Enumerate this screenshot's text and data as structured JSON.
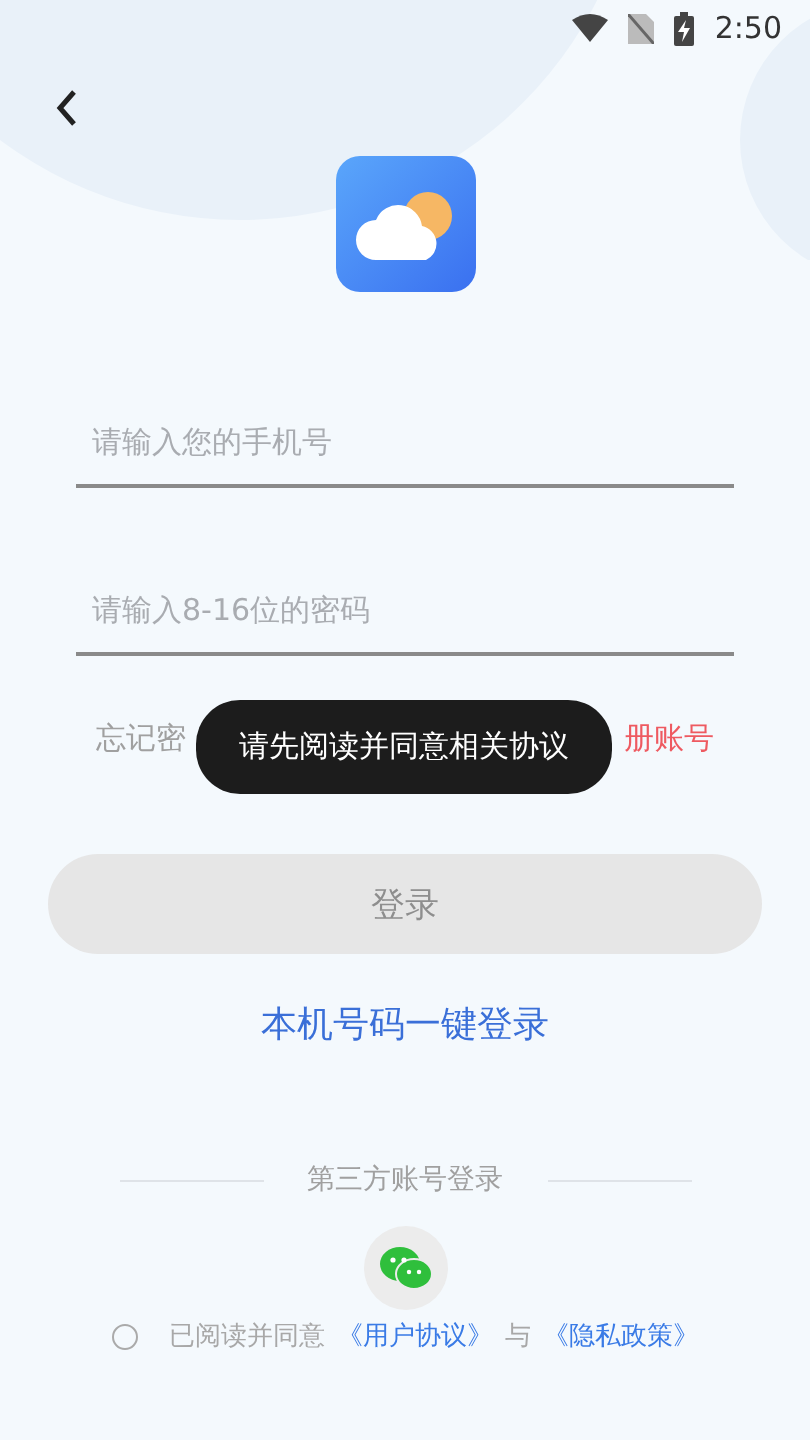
{
  "status_bar": {
    "time": "2:50"
  },
  "phone_field": {
    "placeholder": "请输入您的手机号"
  },
  "password_field": {
    "placeholder": "请输入8-16位的密码"
  },
  "links": {
    "forgot": "忘记密",
    "register": "册账号"
  },
  "toast": {
    "text": "请先阅读并同意相关协议"
  },
  "login_button": {
    "label": "登录",
    "disabled": true
  },
  "quick_login": {
    "label": "本机号码一键登录"
  },
  "third_party": {
    "title": "第三方账号登录"
  },
  "agreement": {
    "checked": false,
    "prefix": "已阅读并同意",
    "user_agreement": "《用户协议》",
    "joiner": "与",
    "privacy_policy": "《隐私政策》"
  }
}
